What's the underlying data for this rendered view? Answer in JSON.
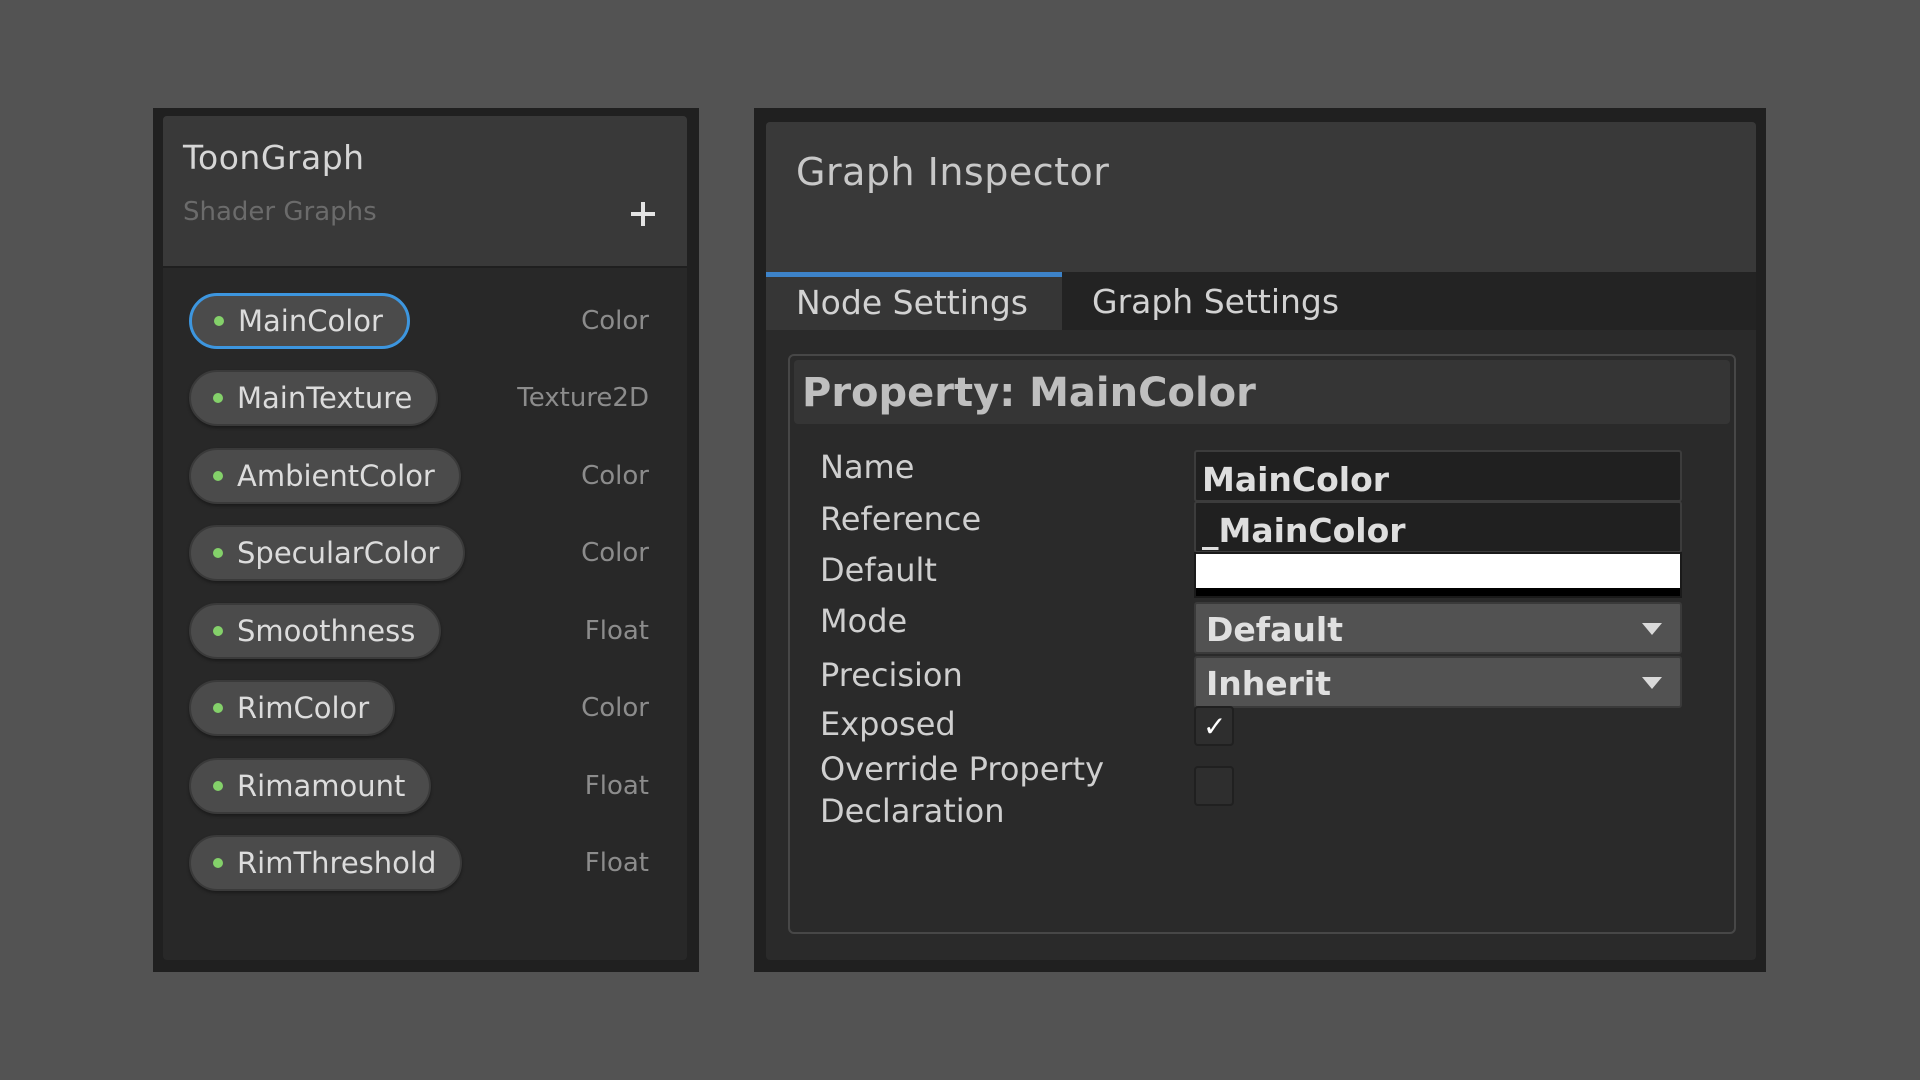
{
  "blackboard": {
    "title": "ToonGraph",
    "subtitle": "Shader Graphs",
    "add_icon": "plus-icon",
    "properties": [
      {
        "name": "MainColor",
        "type": "Color",
        "selected": true
      },
      {
        "name": "MainTexture",
        "type": "Texture2D",
        "selected": false
      },
      {
        "name": "AmbientColor",
        "type": "Color",
        "selected": false
      },
      {
        "name": "SpecularColor",
        "type": "Color",
        "selected": false
      },
      {
        "name": "Smoothness",
        "type": "Float",
        "selected": false
      },
      {
        "name": "RimColor",
        "type": "Color",
        "selected": false
      },
      {
        "name": "Rimamount",
        "type": "Float",
        "selected": false
      },
      {
        "name": "RimThreshold",
        "type": "Float",
        "selected": false
      }
    ]
  },
  "inspector": {
    "title": "Graph Inspector",
    "tabs": [
      {
        "label": "Node Settings",
        "active": true
      },
      {
        "label": "Graph Settings",
        "active": false
      }
    ],
    "property_title": "Property: MainColor",
    "fields": {
      "name_label": "Name",
      "name_value": "MainColor",
      "reference_label": "Reference",
      "reference_value": "_MainColor",
      "default_label": "Default",
      "default_color": "#ffffff",
      "mode_label": "Mode",
      "mode_value": "Default",
      "precision_label": "Precision",
      "precision_value": "Inherit",
      "exposed_label": "Exposed",
      "exposed_checked": true,
      "override_label_line1": "Override Property",
      "override_label_line2": "Declaration",
      "override_checked": false
    }
  },
  "colors": {
    "background": "#535353",
    "accent_blue": "#3d96df",
    "property_dot": "#84d16a"
  }
}
